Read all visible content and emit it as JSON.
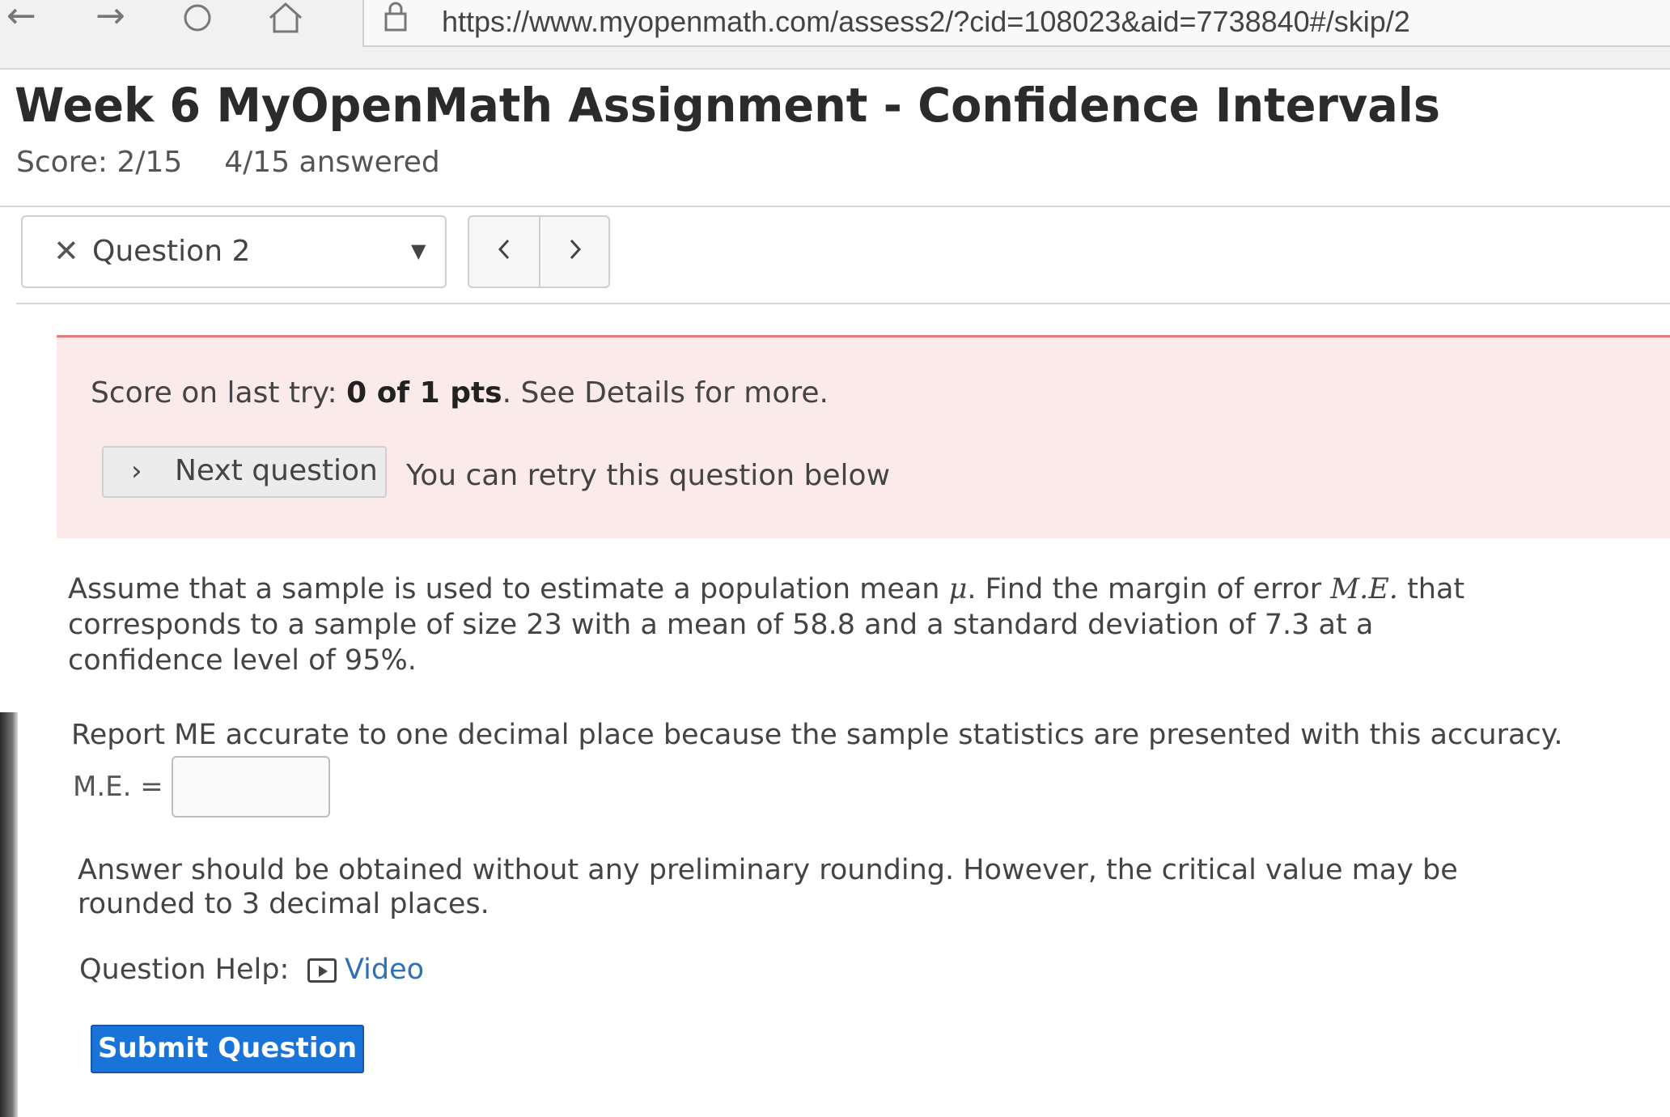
{
  "browser": {
    "back_icon": "arrow-left-icon",
    "forward_icon": "arrow-right-icon",
    "refresh_icon": "refresh-icon",
    "home_icon": "home-icon",
    "lock_icon": "lock-icon",
    "url": "https://www.myopenmath.com/assess2/?cid=108023&aid=7738840#/skip/2"
  },
  "header": {
    "title": "Week 6 MyOpenMath Assignment - Confidence Intervals",
    "score": "Score: 2/15",
    "answered": "4/15 answered"
  },
  "question_nav": {
    "selected": "Question 2",
    "status_icon": "x-icon",
    "prev_icon": "chevron-left-icon",
    "next_icon": "chevron-right-icon"
  },
  "feedback": {
    "prefix": "Score on last try: ",
    "score_bold": "0 of 1 pts",
    "suffix": ". See Details for more.",
    "next_button": "Next question",
    "retry_text": "You can retry this question below",
    "accent_color": "#e37b7b"
  },
  "question": {
    "text_part1": "Assume that a sample is used to estimate a population mean ",
    "mu": "μ",
    "text_part2": ". Find the margin of error ",
    "me_italic": "M.E.",
    "text_part3": " that corresponds to a sample of size 23 with a mean of 58.8 and a standard deviation of 7.3 at a confidence level of 95%.",
    "report": "Report ME accurate to one decimal place because the sample statistics are presented with this accuracy.",
    "me_label": "M.E. =",
    "me_value": "",
    "note": "Answer should be obtained without any preliminary rounding. However, the critical value may be rounded to 3 decimal places.",
    "help_label": "Question Help:",
    "video_label": "Video",
    "submit": "Submit Question"
  },
  "colors": {
    "submit": "#1a73d9",
    "link": "#2f6fb4",
    "feedback_bg": "#fbeaea"
  }
}
